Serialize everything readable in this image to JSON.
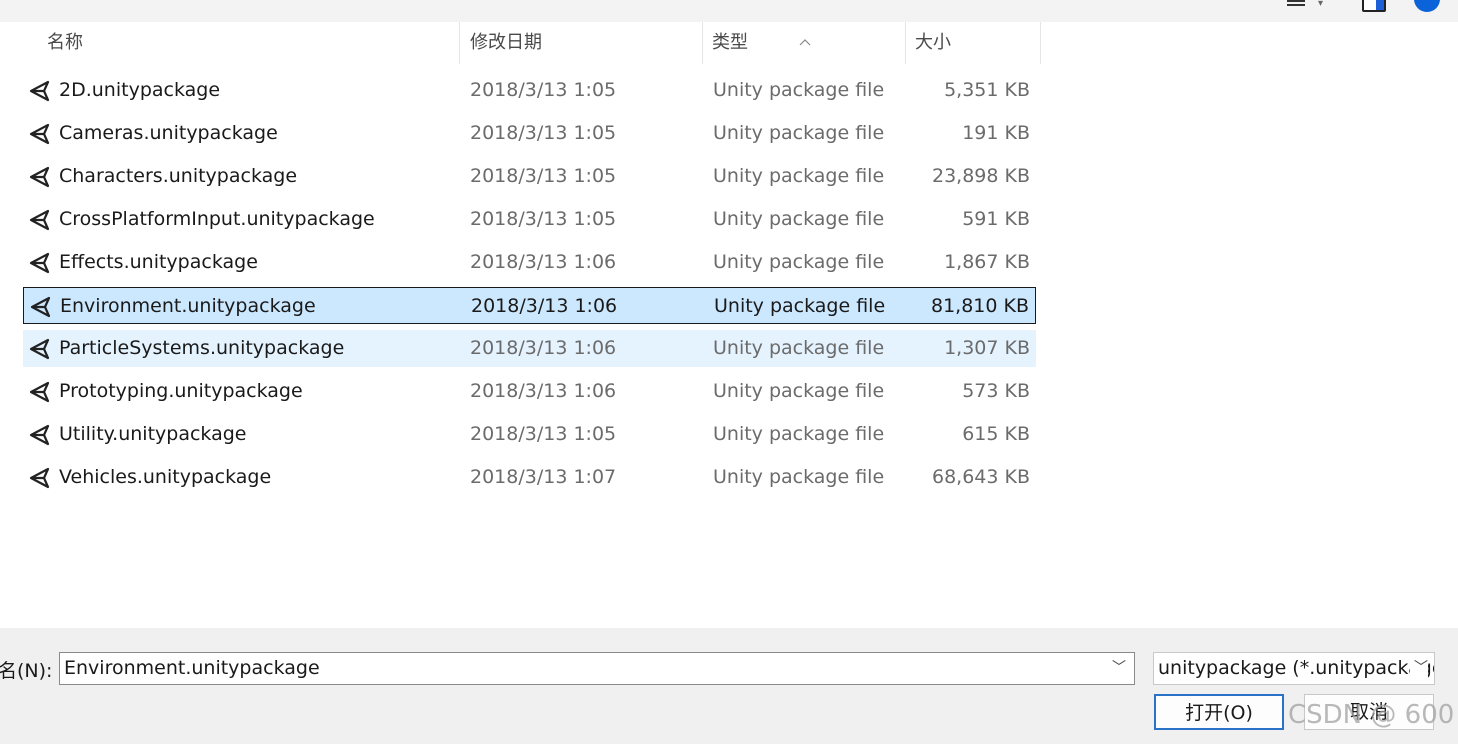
{
  "columns": {
    "name": "名称",
    "date": "修改日期",
    "type": "类型",
    "size": "大小"
  },
  "files": [
    {
      "name": "2D.unitypackage",
      "date": "2018/3/13 1:05",
      "type": "Unity package file",
      "size": "5,351 KB"
    },
    {
      "name": "Cameras.unitypackage",
      "date": "2018/3/13 1:05",
      "type": "Unity package file",
      "size": "191 KB"
    },
    {
      "name": "Characters.unitypackage",
      "date": "2018/3/13 1:05",
      "type": "Unity package file",
      "size": "23,898 KB"
    },
    {
      "name": "CrossPlatformInput.unitypackage",
      "date": "2018/3/13 1:05",
      "type": "Unity package file",
      "size": "591 KB"
    },
    {
      "name": "Effects.unitypackage",
      "date": "2018/3/13 1:06",
      "type": "Unity package file",
      "size": "1,867 KB"
    },
    {
      "name": "Environment.unitypackage",
      "date": "2018/3/13 1:06",
      "type": "Unity package file",
      "size": "81,810 KB",
      "state": "selected"
    },
    {
      "name": "ParticleSystems.unitypackage",
      "date": "2018/3/13 1:06",
      "type": "Unity package file",
      "size": "1,307 KB",
      "state": "hover"
    },
    {
      "name": "Prototyping.unitypackage",
      "date": "2018/3/13 1:06",
      "type": "Unity package file",
      "size": "573 KB"
    },
    {
      "name": "Utility.unitypackage",
      "date": "2018/3/13 1:05",
      "type": "Unity package file",
      "size": "615 KB"
    },
    {
      "name": "Vehicles.unitypackage",
      "date": "2018/3/13 1:07",
      "type": "Unity package file",
      "size": "68,643 KB"
    }
  ],
  "footer": {
    "filename_label": "名(N):",
    "filename_value": "Environment.unitypackage",
    "filter_value": "unitypackage (*.unitypackage)",
    "open_button": "打开(O)",
    "cancel_button": "取消"
  },
  "watermark": "CSDN @ 600",
  "colors": {
    "selected_bg": "#cce8ff",
    "hover_bg": "#e5f3ff",
    "accent": "#2a72c8"
  }
}
